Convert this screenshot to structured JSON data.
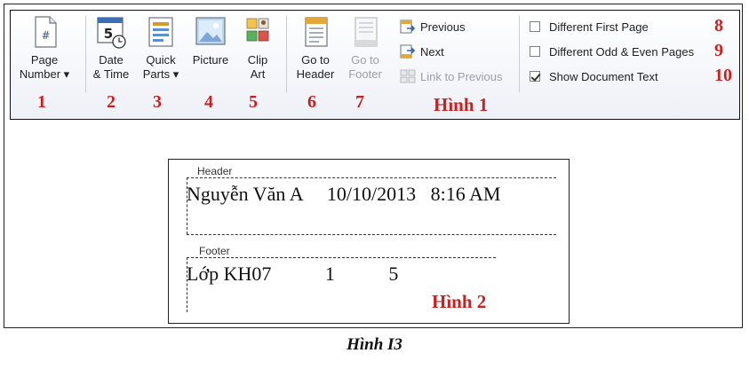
{
  "ribbon": {
    "buttons": [
      {
        "line1": "Page",
        "line2": "Number ▾",
        "num": "1",
        "icon": "page-number-icon"
      },
      {
        "line1": "Date",
        "line2": "& Time",
        "num": "2",
        "icon": "date-time-icon"
      },
      {
        "line1": "Quick",
        "line2": "Parts ▾",
        "num": "3",
        "icon": "quick-parts-icon"
      },
      {
        "line1": "Picture",
        "line2": "",
        "num": "4",
        "icon": "picture-icon"
      },
      {
        "line1": "Clip",
        "line2": "Art",
        "num": "5",
        "icon": "clip-art-icon"
      },
      {
        "line1": "Go to",
        "line2": "Header",
        "num": "6",
        "icon": "go-to-header-icon"
      },
      {
        "line1": "Go to",
        "line2": "Footer",
        "num": "7",
        "icon": "go-to-footer-icon"
      }
    ],
    "nav": {
      "previous": "Previous",
      "next": "Next",
      "link_to_previous": "Link to Previous"
    },
    "options": [
      {
        "label": "Different First Page",
        "checked": false,
        "num": "8"
      },
      {
        "label": "Different Odd & Even Pages",
        "checked": false,
        "num": "9"
      },
      {
        "label": "Show Document Text",
        "checked": true,
        "num": "10"
      }
    ],
    "figure_label": "Hình 1"
  },
  "document": {
    "header_tag": "Header",
    "header_text": "Nguyễn Văn A     10/10/2013   8:16 AM",
    "footer_tag": "Footer",
    "footer_text": "Lớp KH07           1           5",
    "figure_label": "Hình 2"
  },
  "caption": "Hình I3",
  "colors": {
    "accent_red": "#cc1f1f",
    "ribbon_bg": "#f4f6fa"
  }
}
